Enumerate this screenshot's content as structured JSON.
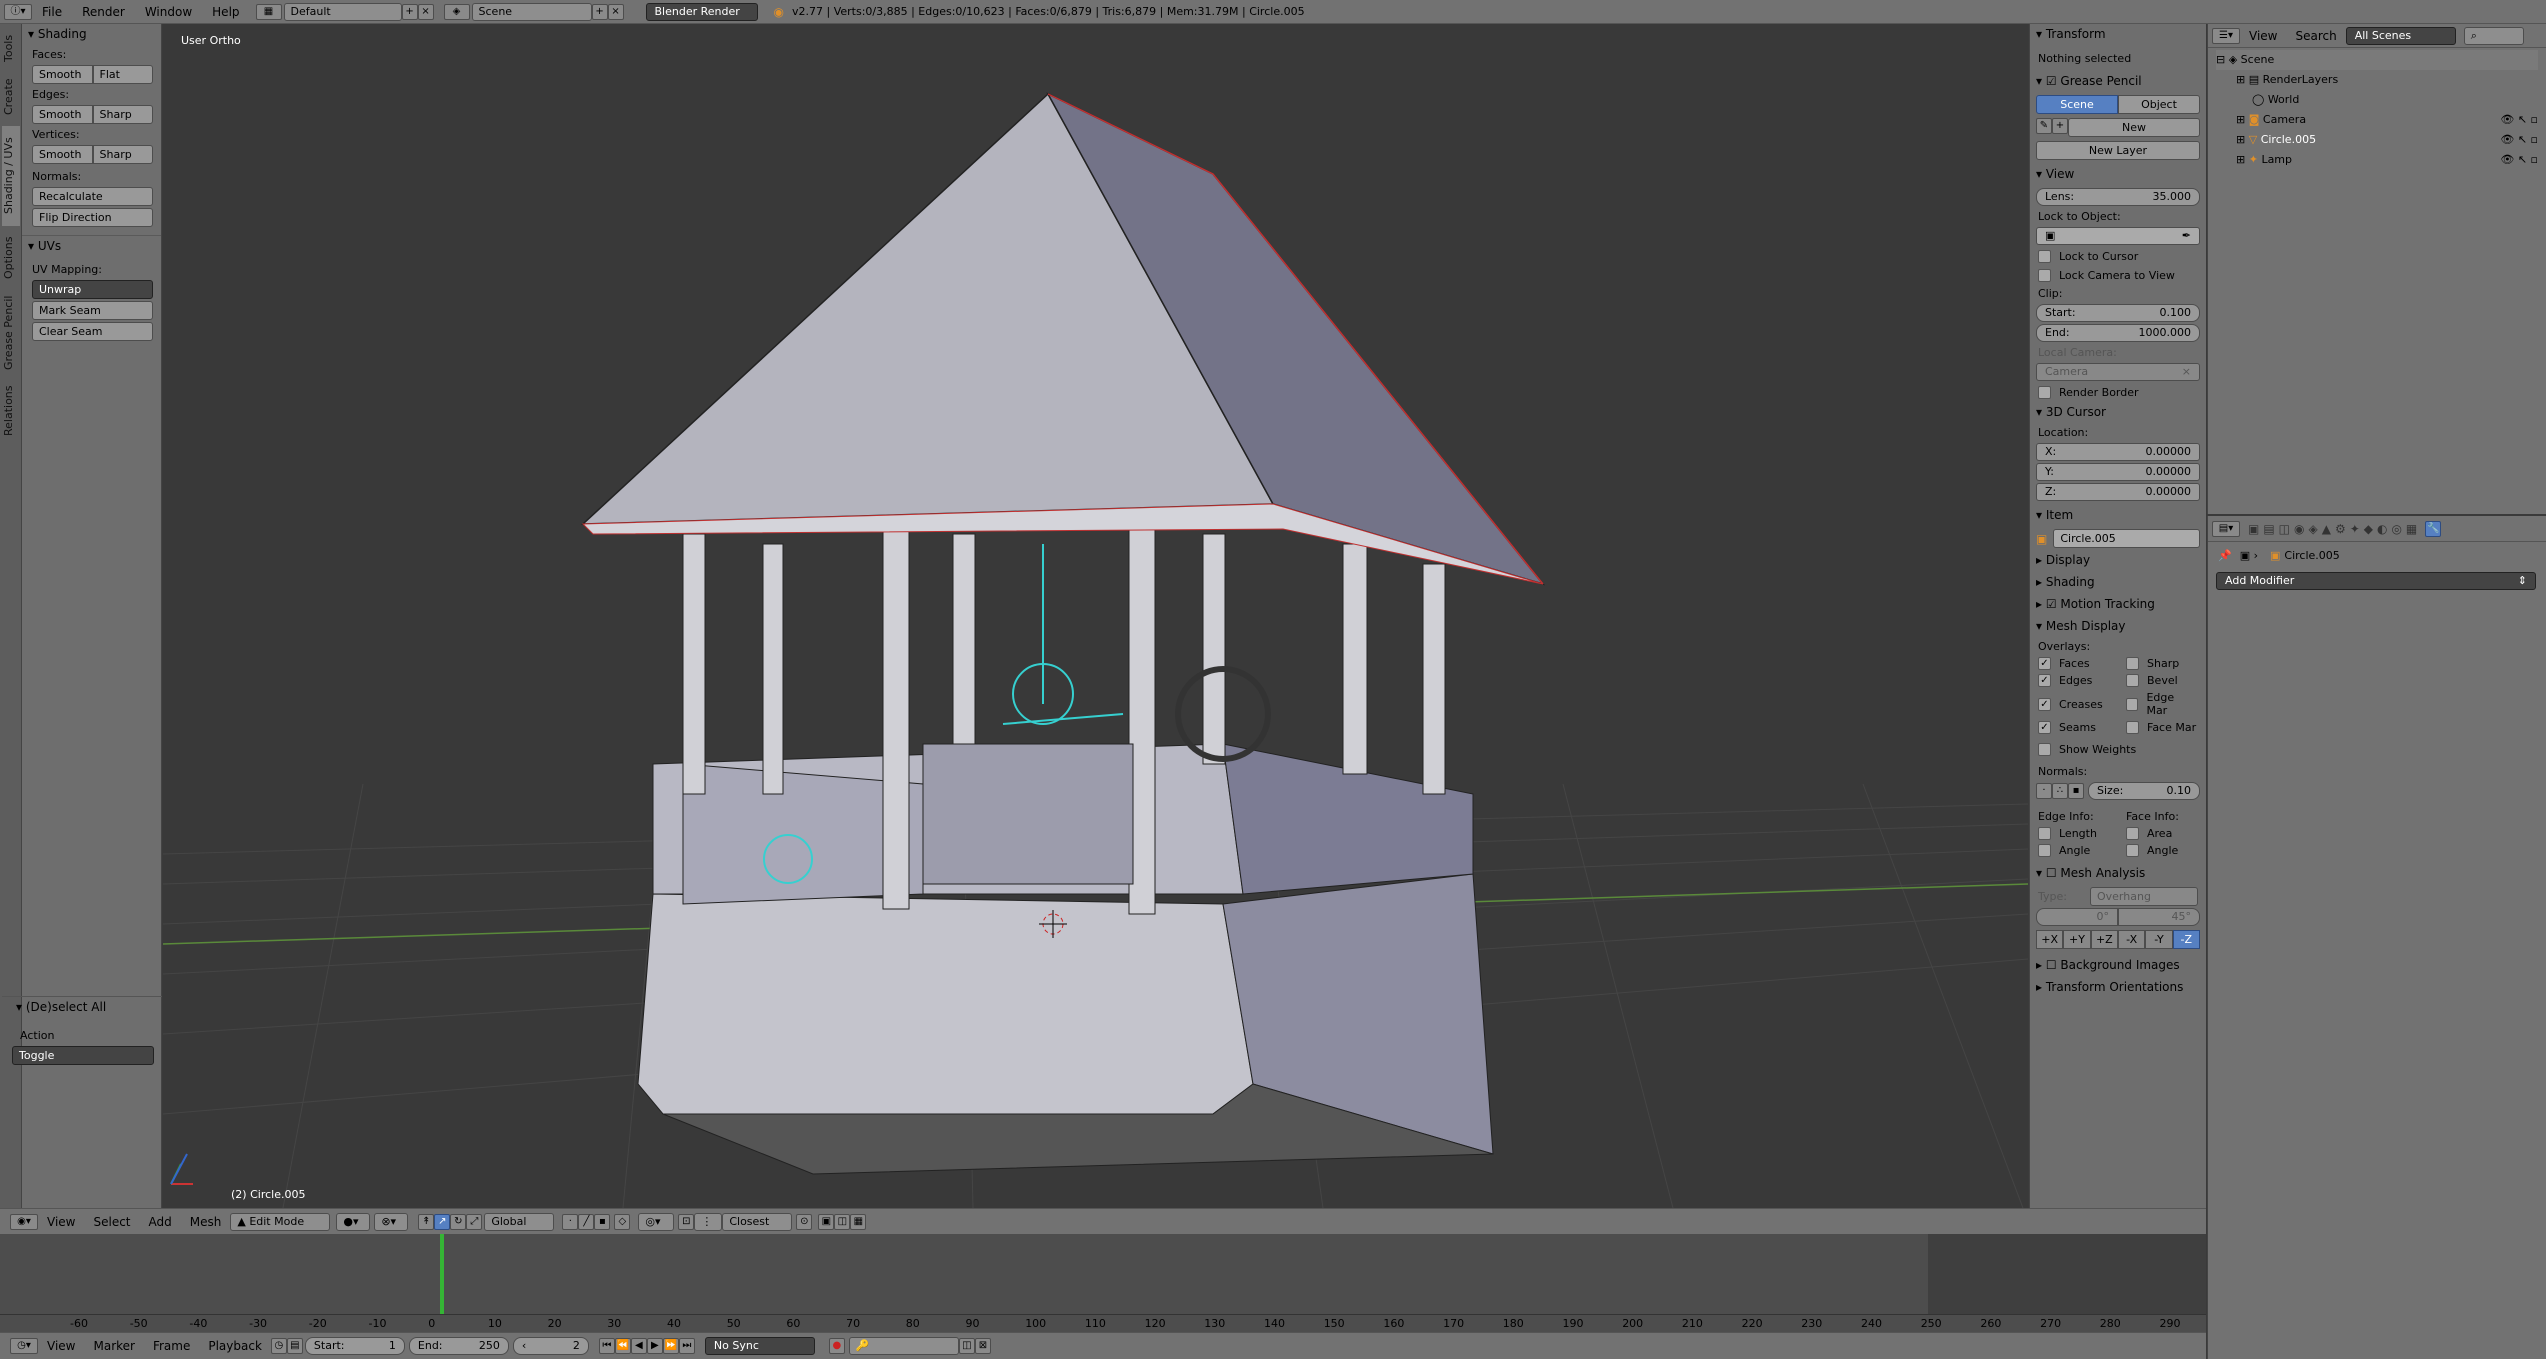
{
  "topbar": {
    "menus": [
      "File",
      "Render",
      "Window",
      "Help"
    ],
    "layout": "Default",
    "scene": "Scene",
    "engine": "Blender Render",
    "stats": "v2.77 | Verts:0/3,885 | Edges:0/10,623 | Faces:0/6,879 | Tris:6,879 | Mem:31.79M | Circle.005"
  },
  "vtabs": [
    "Tools",
    "Create",
    "Shading / UVs",
    "Options",
    "Grease Pencil",
    "Relations"
  ],
  "tools": {
    "shading_title": "Shading",
    "faces_label": "Faces:",
    "smooth": "Smooth",
    "flat": "Flat",
    "edges_label": "Edges:",
    "sharp": "Sharp",
    "vertices_label": "Vertices:",
    "normals_label": "Normals:",
    "recalculate": "Recalculate",
    "flip": "Flip Direction",
    "uvs_title": "UVs",
    "uv_mapping": "UV Mapping:",
    "unwrap": "Unwrap",
    "mark_seam": "Mark Seam",
    "clear_seam": "Clear Seam",
    "op_title": "(De)select All",
    "action_label": "Action",
    "action_value": "Toggle"
  },
  "viewport": {
    "view_name": "User Ortho",
    "object_info": "(2) Circle.005"
  },
  "npanel": {
    "transform": "Transform",
    "nothing": "Nothing selected",
    "grease": "Grease Pencil",
    "scene": "Scene",
    "object": "Object",
    "new": "New",
    "new_layer": "New Layer",
    "view": "View",
    "lens_label": "Lens:",
    "lens_value": "35.000",
    "lock_obj": "Lock to Object:",
    "lock_cursor": "Lock to Cursor",
    "lock_camera": "Lock Camera to View",
    "clip": "Clip:",
    "start_label": "Start:",
    "start_value": "0.100",
    "end_label": "End:",
    "end_value": "1000.000",
    "local_camera": "Local Camera:",
    "camera": "Camera",
    "render_border": "Render Border",
    "cursor3d": "3D Cursor",
    "location": "Location:",
    "x_label": "X:",
    "x_value": "0.00000",
    "y_label": "Y:",
    "y_value": "0.00000",
    "z_label": "Z:",
    "z_value": "0.00000",
    "item": "Item",
    "item_name": "Circle.005",
    "display": "Display",
    "shading": "Shading",
    "motion": "Motion Tracking",
    "mesh_display": "Mesh Display",
    "overlays": "Overlays:",
    "faces": "Faces",
    "sharp": "Sharp",
    "edges": "Edges",
    "bevel": "Bevel",
    "creases": "Creases",
    "edge_mar": "Edge Mar",
    "seams": "Seams",
    "face_mar": "Face Mar",
    "show_weights": "Show Weights",
    "normals": "Normals:",
    "size_label": "Size:",
    "size_value": "0.10",
    "edge_info": "Edge Info:",
    "face_info": "Face Info:",
    "length": "Length",
    "area": "Area",
    "angle": "Angle",
    "angle2": "Angle",
    "mesh_analysis": "Mesh Analysis",
    "type_label": "Type:",
    "type_value": "Overhang",
    "deg0": "0°",
    "deg45": "45°",
    "axes": [
      "+X",
      "+Y",
      "+Z",
      "-X",
      "-Y",
      "-Z"
    ],
    "bg_images": "Background Images",
    "transform_or": "Transform Orientations"
  },
  "outliner": {
    "view": "View",
    "search": "Search",
    "all_scenes": "All Scenes",
    "items": [
      "Scene",
      "RenderLayers",
      "World",
      "Camera",
      "Circle.005",
      "Lamp"
    ]
  },
  "props": {
    "object": "Circle.005",
    "add_modifier": "Add Modifier"
  },
  "vhead": {
    "menus": [
      "View",
      "Select",
      "Add",
      "Mesh"
    ],
    "mode": "Edit Mode",
    "orientation": "Global",
    "snap": "Closest"
  },
  "timeline": {
    "ticks": [
      "-60",
      "-50",
      "-40",
      "-30",
      "-20",
      "-10",
      "0",
      "10",
      "20",
      "30",
      "40",
      "50",
      "60",
      "70",
      "80",
      "90",
      "100",
      "110",
      "120",
      "130",
      "140",
      "150",
      "160",
      "170",
      "180",
      "190",
      "200",
      "210",
      "220",
      "230",
      "240",
      "250",
      "260",
      "270",
      "280",
      "290"
    ]
  },
  "thead": {
    "menus": [
      "View",
      "Marker",
      "Frame",
      "Playback"
    ],
    "start_label": "Start:",
    "start_value": "1",
    "end_label": "End:",
    "end_value": "250",
    "current": "2",
    "sync": "No Sync"
  }
}
